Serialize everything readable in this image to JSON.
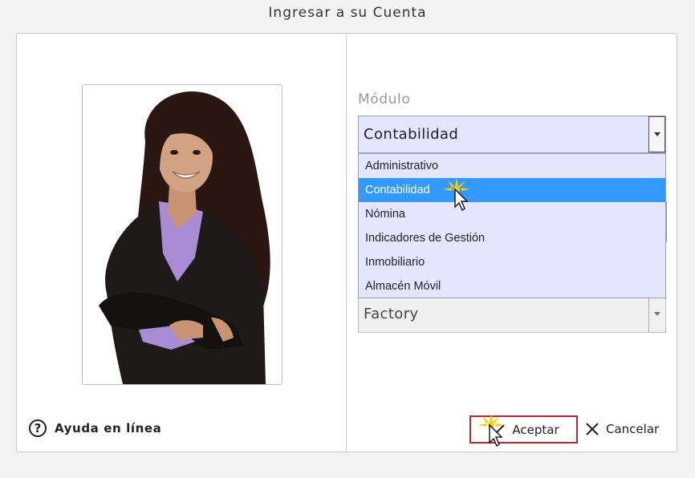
{
  "window": {
    "title": "Ingresar a su Cuenta"
  },
  "help": {
    "icon": "question-circle-icon",
    "label": "Ayuda en línea"
  },
  "modulo": {
    "label": "Módulo",
    "selected": "Contabilidad",
    "options": [
      "Administrativo",
      "Contabilidad",
      "Nómina",
      "Indicadores de Gestión",
      "Inmobiliario",
      "Almacén Móvil"
    ],
    "highlighted": "Contabilidad"
  },
  "company": {
    "value": "Factory"
  },
  "buttons": {
    "accept": "Aceptar",
    "cancel": "Cancelar"
  },
  "colors": {
    "highlight": "#3399ff",
    "select_bg": "#e4e6ff",
    "accept_border": "#b8272f"
  }
}
